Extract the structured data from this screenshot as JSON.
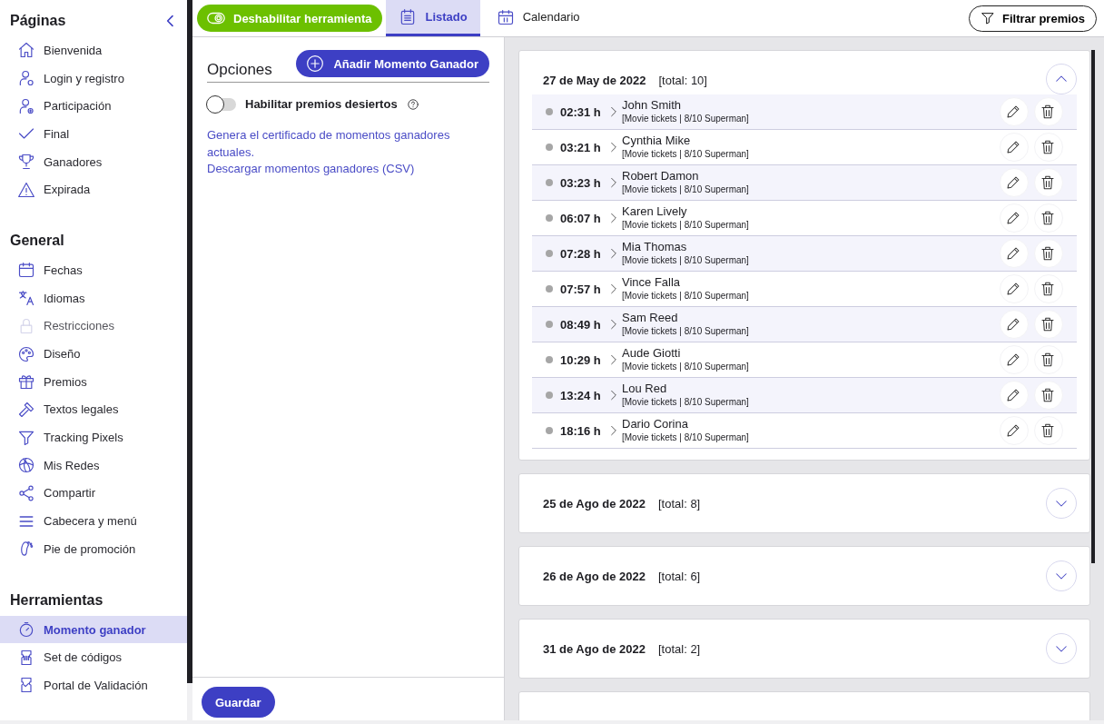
{
  "sidebar": {
    "sections": [
      {
        "title": "Páginas",
        "items": [
          {
            "label": "Bienvenida",
            "selected": false,
            "disabled": false
          },
          {
            "label": "Login y registro",
            "selected": false,
            "disabled": false
          },
          {
            "label": "Participación",
            "selected": false,
            "disabled": false
          },
          {
            "label": "Final",
            "selected": false,
            "disabled": false
          },
          {
            "label": "Ganadores",
            "selected": false,
            "disabled": false
          },
          {
            "label": "Expirada",
            "selected": false,
            "disabled": false
          }
        ]
      },
      {
        "title": "General",
        "items": [
          {
            "label": "Fechas",
            "selected": false,
            "disabled": false
          },
          {
            "label": "Idiomas",
            "selected": false,
            "disabled": false
          },
          {
            "label": "Restricciones",
            "selected": false,
            "disabled": true
          },
          {
            "label": "Diseño",
            "selected": false,
            "disabled": false
          },
          {
            "label": "Premios",
            "selected": false,
            "disabled": false
          },
          {
            "label": "Textos legales",
            "selected": false,
            "disabled": false
          },
          {
            "label": "Tracking Pixels",
            "selected": false,
            "disabled": false
          },
          {
            "label": "Mis Redes",
            "selected": false,
            "disabled": false
          },
          {
            "label": "Compartir",
            "selected": false,
            "disabled": false
          },
          {
            "label": "Cabecera y menú",
            "selected": false,
            "disabled": false
          },
          {
            "label": "Pie de promoción",
            "selected": false,
            "disabled": false
          }
        ]
      },
      {
        "title": "Herramientas",
        "items": [
          {
            "label": "Momento ganador",
            "selected": true,
            "disabled": false
          },
          {
            "label": "Set de códigos",
            "selected": false,
            "disabled": false
          },
          {
            "label": "Portal de Validación",
            "selected": false,
            "disabled": false
          }
        ]
      }
    ]
  },
  "toolbar": {
    "toggle_button": "Deshabilitar herramienta",
    "tabs": [
      {
        "label": "Listado",
        "selected": true
      },
      {
        "label": "Calendario",
        "selected": false
      }
    ],
    "filter_button": "Filtrar premios"
  },
  "options": {
    "title": "Opciones",
    "add_button": "Añadir Momento Ganador",
    "switch": {
      "label": "Habilitar premios desiertos",
      "on": false
    },
    "links": [
      "Genera el certificado de momentos ganadores actuales.",
      "Descargar momentos ganadores (CSV)"
    ],
    "save_button": "Guardar"
  },
  "days": [
    {
      "date": "27 de May de 2022",
      "total": "[total: 10]",
      "expanded": true,
      "moments": [
        {
          "time": "02:31 h",
          "name": "John Smith",
          "prize": "[Movie tickets | 8/10 Superman]"
        },
        {
          "time": "03:21 h",
          "name": "Cynthia Mike",
          "prize": "[Movie tickets | 8/10 Superman]"
        },
        {
          "time": "03:23 h",
          "name": "Robert Damon",
          "prize": "[Movie tickets | 8/10 Superman]"
        },
        {
          "time": "06:07 h",
          "name": "Karen Lively",
          "prize": "[Movie tickets | 8/10 Superman]"
        },
        {
          "time": "07:28 h",
          "name": "Mia Thomas",
          "prize": "[Movie tickets | 8/10 Superman]"
        },
        {
          "time": "07:57 h",
          "name": "Vince Falla",
          "prize": "[Movie tickets | 8/10 Superman]"
        },
        {
          "time": "08:49 h",
          "name": "Sam Reed",
          "prize": "[Movie tickets | 8/10 Superman]"
        },
        {
          "time": "10:29 h",
          "name": "Aude Giotti",
          "prize": "[Movie tickets | 8/10 Superman]"
        },
        {
          "time": "13:24 h",
          "name": "Lou Red",
          "prize": "[Movie tickets | 8/10 Superman]"
        },
        {
          "time": "18:16 h",
          "name": "Dario Corina",
          "prize": "[Movie tickets | 8/10 Superman]"
        }
      ]
    },
    {
      "date": "25 de Ago de 2022",
      "total": "[total: 8]",
      "expanded": false
    },
    {
      "date": "26 de Ago de 2022",
      "total": "[total: 6]",
      "expanded": false
    },
    {
      "date": "31 de Ago de 2022",
      "total": "[total: 2]",
      "expanded": false
    }
  ]
}
